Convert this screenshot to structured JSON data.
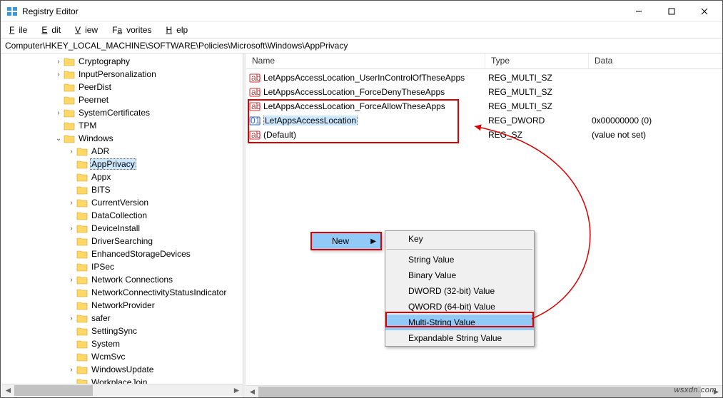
{
  "window": {
    "title": "Registry Editor",
    "min": "—",
    "max": "□",
    "close": "✕"
  },
  "menubar": {
    "file": "File",
    "edit": "Edit",
    "view": "View",
    "favorites": "Favorites",
    "help": "Help"
  },
  "address": "Computer\\HKEY_LOCAL_MACHINE\\SOFTWARE\\Policies\\Microsoft\\Windows\\AppPrivacy",
  "columns": {
    "name": "Name",
    "type": "Type",
    "data": "Data"
  },
  "values": [
    {
      "icon": "sz",
      "name": "(Default)",
      "type": "REG_SZ",
      "data": "(value not set)",
      "selected": false
    },
    {
      "icon": "dw",
      "name": "LetAppsAccessLocation",
      "type": "REG_DWORD",
      "data": "0x00000000 (0)",
      "selected": true
    },
    {
      "icon": "sz",
      "name": "LetAppsAccessLocation_ForceAllowTheseApps",
      "type": "REG_MULTI_SZ",
      "data": "",
      "selected": false
    },
    {
      "icon": "sz",
      "name": "LetAppsAccessLocation_ForceDenyTheseApps",
      "type": "REG_MULTI_SZ",
      "data": "",
      "selected": false
    },
    {
      "icon": "sz",
      "name": "LetAppsAccessLocation_UserInControlOfTheseApps",
      "type": "REG_MULTI_SZ",
      "data": "",
      "selected": false
    }
  ],
  "tree": [
    {
      "d": 4,
      "t": ">",
      "n": "Cryptography"
    },
    {
      "d": 4,
      "t": ">",
      "n": "InputPersonalization"
    },
    {
      "d": 4,
      "t": "",
      "n": "PeerDist"
    },
    {
      "d": 4,
      "t": "",
      "n": "Peernet"
    },
    {
      "d": 4,
      "t": ">",
      "n": "SystemCertificates"
    },
    {
      "d": 4,
      "t": "",
      "n": "TPM"
    },
    {
      "d": 4,
      "t": "v",
      "n": "Windows"
    },
    {
      "d": 5,
      "t": ">",
      "n": "ADR"
    },
    {
      "d": 5,
      "t": "",
      "n": "AppPrivacy",
      "sel": true
    },
    {
      "d": 5,
      "t": "",
      "n": "Appx"
    },
    {
      "d": 5,
      "t": "",
      "n": "BITS"
    },
    {
      "d": 5,
      "t": ">",
      "n": "CurrentVersion"
    },
    {
      "d": 5,
      "t": "",
      "n": "DataCollection"
    },
    {
      "d": 5,
      "t": ">",
      "n": "DeviceInstall"
    },
    {
      "d": 5,
      "t": "",
      "n": "DriverSearching"
    },
    {
      "d": 5,
      "t": "",
      "n": "EnhancedStorageDevices"
    },
    {
      "d": 5,
      "t": "",
      "n": "IPSec"
    },
    {
      "d": 5,
      "t": ">",
      "n": "Network Connections"
    },
    {
      "d": 5,
      "t": "",
      "n": "NetworkConnectivityStatusIndicator"
    },
    {
      "d": 5,
      "t": "",
      "n": "NetworkProvider"
    },
    {
      "d": 5,
      "t": ">",
      "n": "safer"
    },
    {
      "d": 5,
      "t": "",
      "n": "SettingSync"
    },
    {
      "d": 5,
      "t": "",
      "n": "System"
    },
    {
      "d": 5,
      "t": "",
      "n": "WcmSvc"
    },
    {
      "d": 5,
      "t": ">",
      "n": "WindowsUpdate"
    },
    {
      "d": 5,
      "t": "",
      "n": "WorkplaceJoin"
    }
  ],
  "ctx_parent": {
    "label": "New"
  },
  "ctx_sub": [
    {
      "label": "Key",
      "sep_after": true
    },
    {
      "label": "String Value"
    },
    {
      "label": "Binary Value"
    },
    {
      "label": "DWORD (32-bit) Value"
    },
    {
      "label": "QWORD (64-bit) Value"
    },
    {
      "label": "Multi-String Value",
      "hl": true
    },
    {
      "label": "Expandable String Value"
    }
  ],
  "watermark": "wsxdn.com"
}
